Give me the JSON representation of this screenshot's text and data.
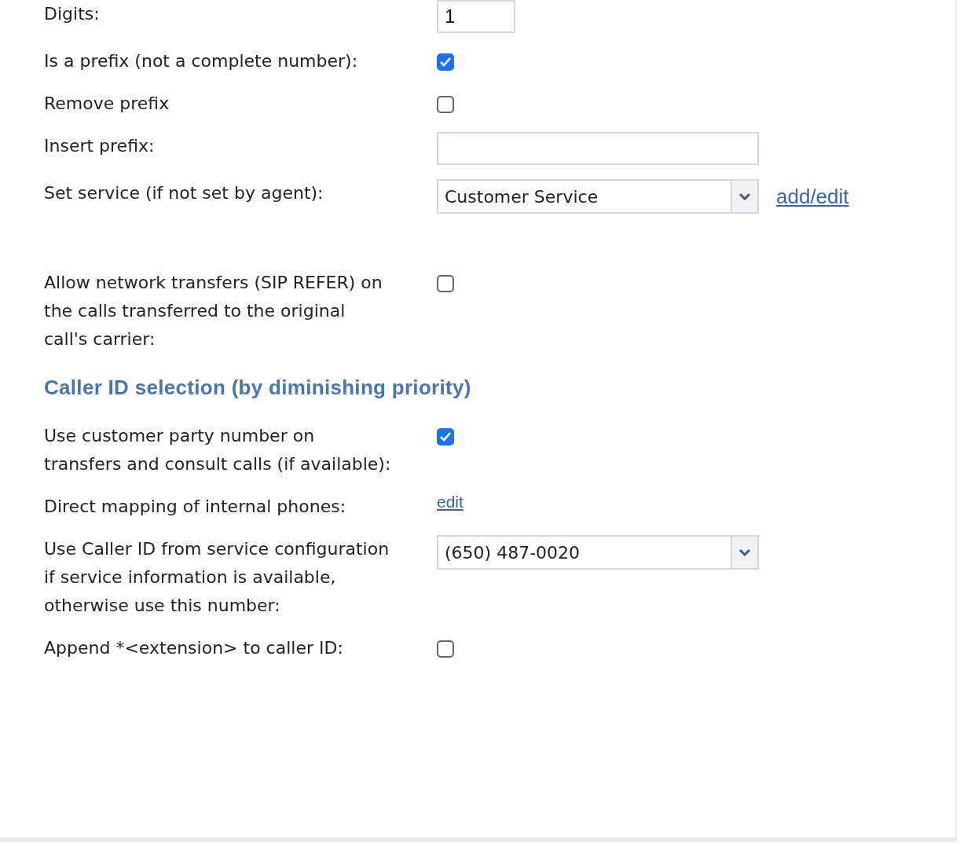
{
  "sections": [
    {
      "rows": [
        {
          "kind": "short_text",
          "label": "Digits:",
          "value": "1"
        },
        {
          "kind": "checkbox",
          "label": "Is a prefix (not a complete number):",
          "checked": true
        },
        {
          "kind": "checkbox",
          "label": "Remove prefix",
          "checked": false
        },
        {
          "kind": "text",
          "label": "Insert prefix:",
          "value": ""
        },
        {
          "kind": "select",
          "label": "Set service (if not set by agent):",
          "value": "Customer Service",
          "link": "add/edit"
        },
        {
          "kind": "checkbox",
          "label": "Allow network transfers (SIP REFER) on the calls transferred to the original call's carrier:",
          "checked": false
        }
      ]
    },
    {
      "heading": "Caller ID selection (by diminishing priority)",
      "rows": [
        {
          "kind": "checkbox",
          "label": "Use customer party number on transfers and consult calls (if available):",
          "checked": true
        },
        {
          "kind": "link",
          "label": "Direct mapping of internal phones:",
          "link": "edit"
        },
        {
          "kind": "select",
          "label": "Use Caller ID from service configuration if service information is available, otherwise use this number:",
          "value": "(650) 487-0020"
        },
        {
          "kind": "checkbox",
          "label": "Append *<extension> to caller ID:",
          "checked": false
        }
      ]
    }
  ]
}
